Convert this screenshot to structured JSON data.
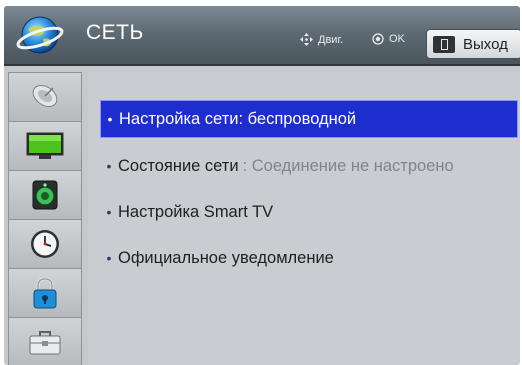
{
  "header": {
    "title": "СЕТЬ",
    "hint_move": "Двиг.",
    "hint_ok": "OK",
    "exit_label": "Выход"
  },
  "sidebar": {
    "items": [
      {
        "icon": "satellite-dish-icon"
      },
      {
        "icon": "tv-picture-icon"
      },
      {
        "icon": "speaker-audio-icon"
      },
      {
        "icon": "clock-icon"
      },
      {
        "icon": "padlock-icon"
      },
      {
        "icon": "toolbox-icon"
      }
    ]
  },
  "menu": {
    "items": [
      {
        "label": "Настройка сети: беспроводной",
        "selected": true
      },
      {
        "label": "Состояние сети",
        "status": ": Соединение не настроено",
        "selected": false
      },
      {
        "label": "Настройка Smart TV",
        "selected": false
      },
      {
        "label": "Официальное уведомление",
        "selected": false
      }
    ]
  },
  "colors": {
    "selected_bg": "#1e2dd0",
    "content_bg": "#c9ccd0",
    "status_text": "#7e868c"
  }
}
